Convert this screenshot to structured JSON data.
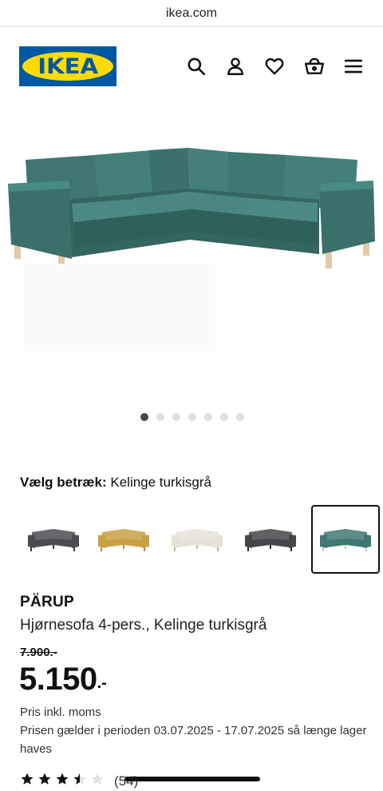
{
  "browser": {
    "url": "ikea.com"
  },
  "header": {
    "logo_text": "IKEA",
    "icons": [
      "search-icon",
      "user-icon",
      "heart-icon",
      "basket-icon",
      "menu-icon"
    ]
  },
  "gallery": {
    "image_count": 7,
    "active_index": 0
  },
  "cover": {
    "label": "Vælg betræk:",
    "value": "Kelinge turkisgrå"
  },
  "swatches": [
    {
      "color": "#4a4c51",
      "legs": "#3a3a3a"
    },
    {
      "color": "#c9a043",
      "legs": "#b08a5a"
    },
    {
      "color": "#e7e2d8",
      "legs": "#c8b49a"
    },
    {
      "color": "#454649",
      "legs": "#2b2b2b"
    },
    {
      "color": "#3f7872",
      "legs": "#d9c4a0"
    }
  ],
  "selected_swatch": 4,
  "product": {
    "name": "PÄRUP",
    "description": "Hjørnesofa 4-pers., Kelinge turkisgrå",
    "old_price": "7.900.-",
    "price": "5.150",
    "price_suffix": ".-",
    "vat_note": "Pris inkl. moms",
    "period_note": "Prisen gælder i perioden 03.07.2025 - 17.07.2025 så længe lager haves"
  },
  "rating": {
    "stars": 3.5,
    "max": 5,
    "count_text": "(54)"
  },
  "colors": {
    "ikea_blue": "#0058a3",
    "ikea_yellow": "#ffdb00",
    "sofa": "#3f7872"
  }
}
